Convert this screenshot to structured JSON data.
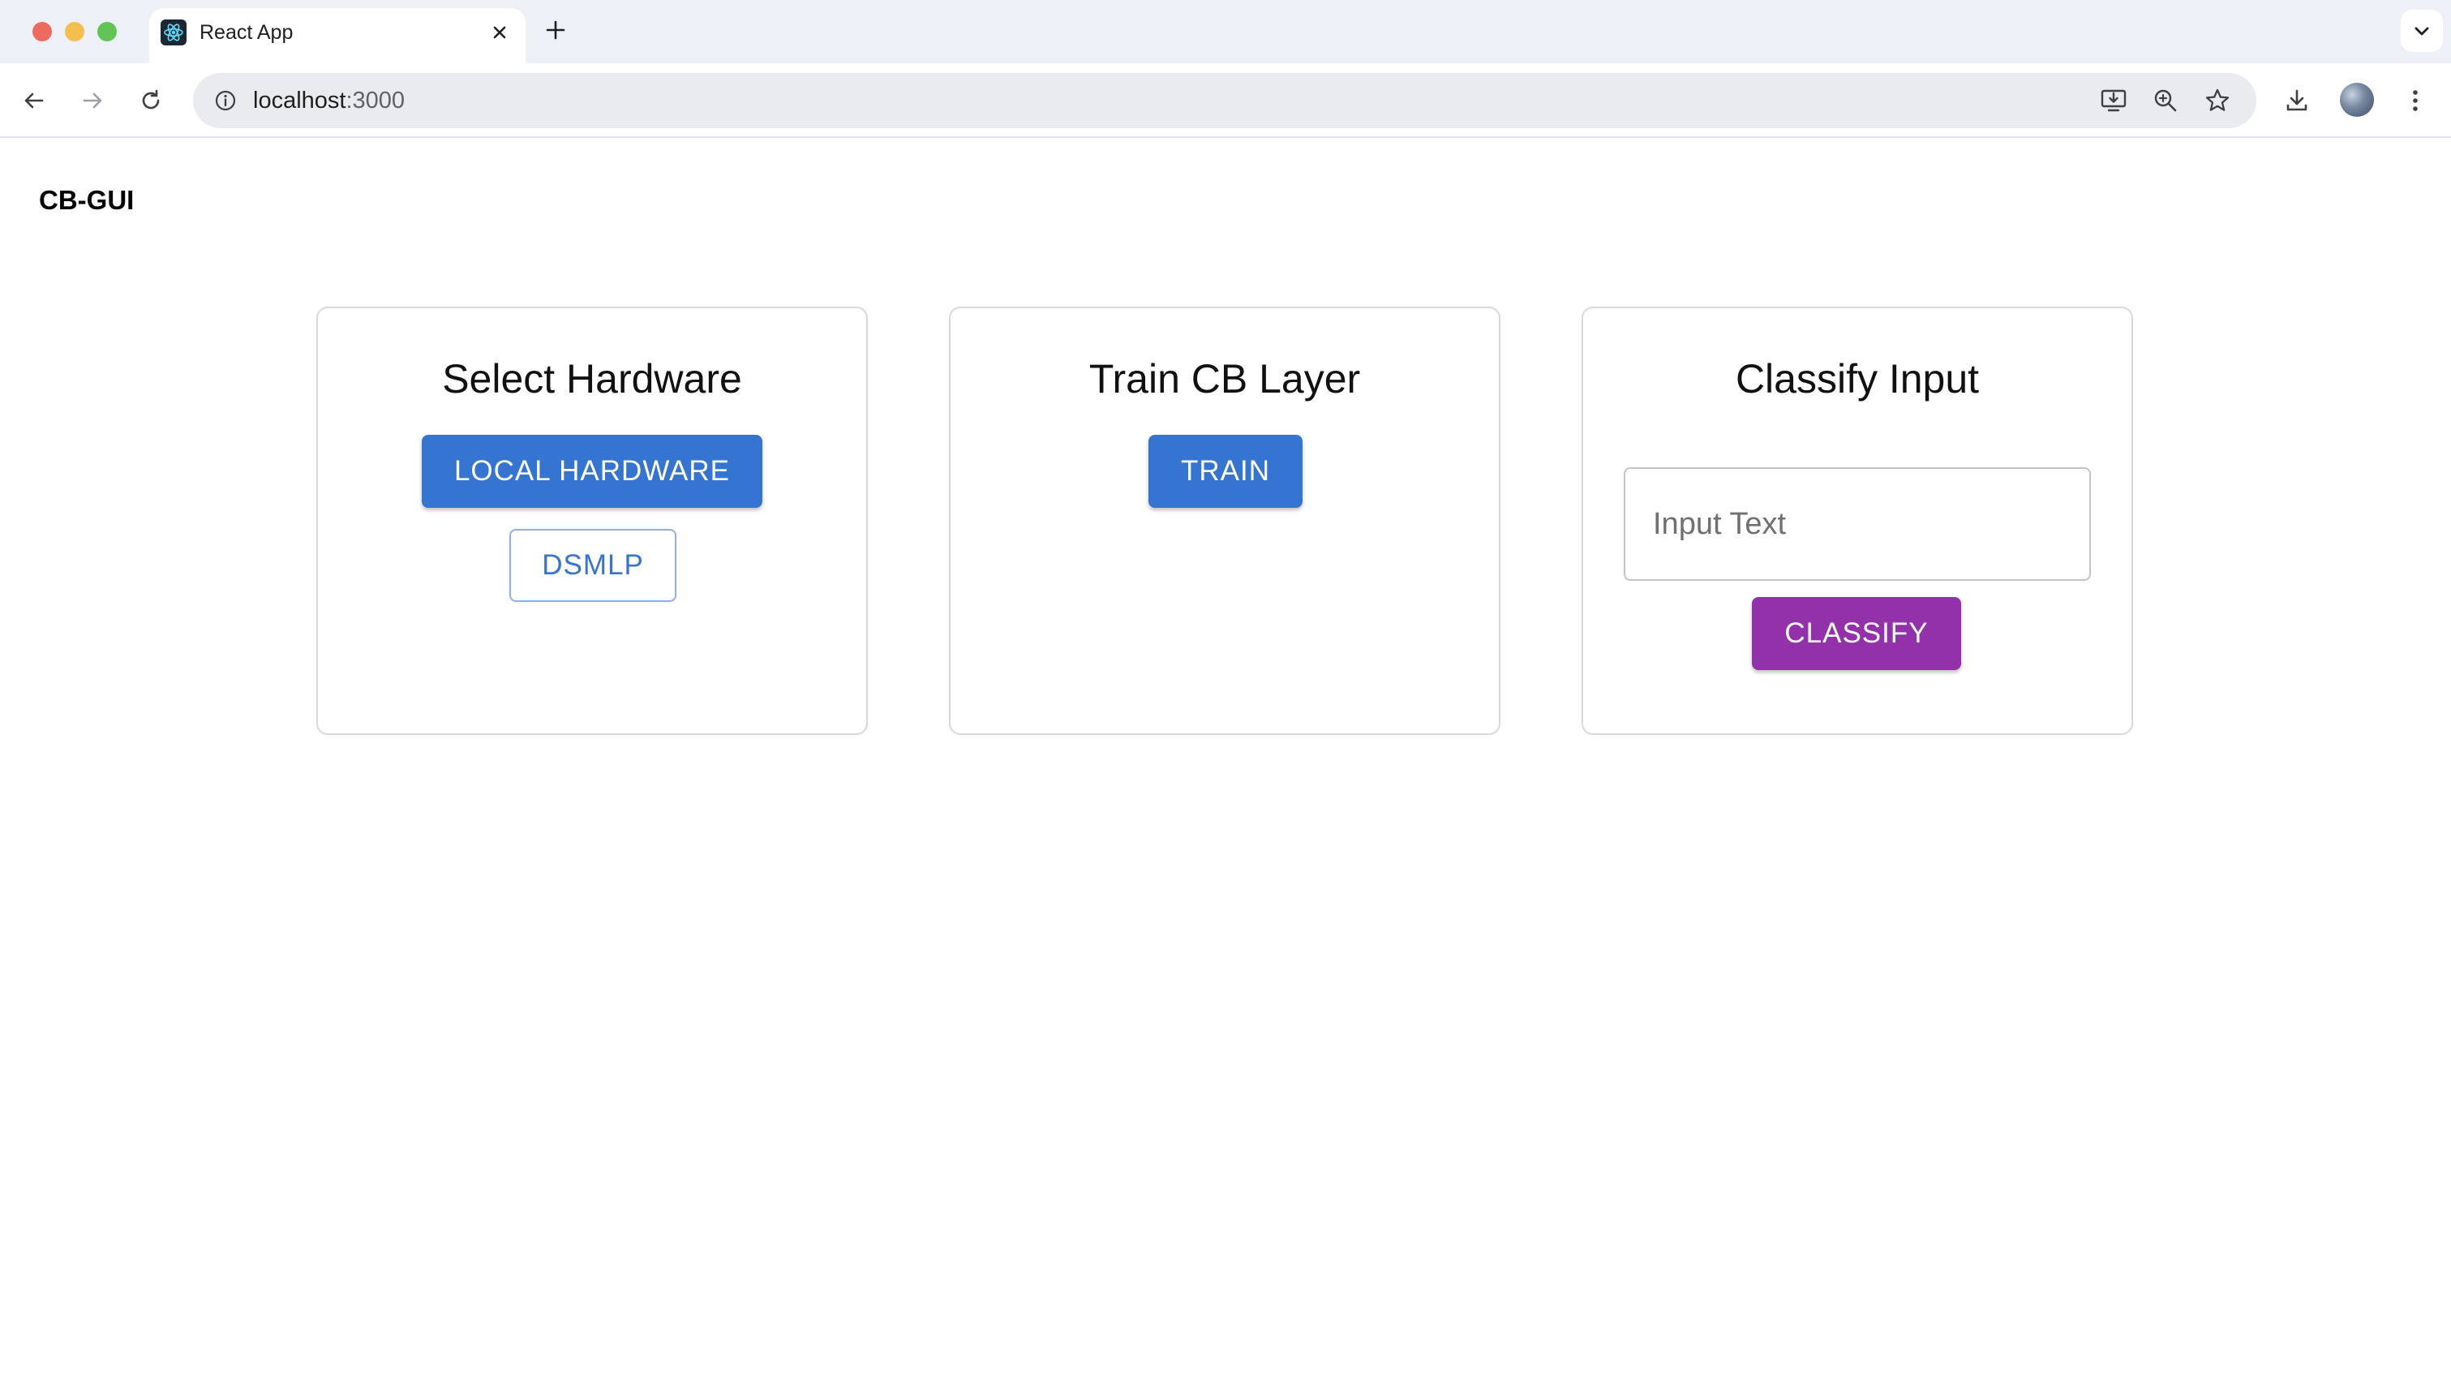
{
  "browser": {
    "tab": {
      "title": "React App"
    },
    "address": {
      "host": "localhost",
      "port": ":3000"
    }
  },
  "app": {
    "title": "CB-GUI"
  },
  "cards": {
    "hardware": {
      "title": "Select Hardware",
      "primary_label": "LOCAL HARDWARE",
      "secondary_label": "DSMLP"
    },
    "train": {
      "title": "Train CB Layer",
      "button_label": "TRAIN"
    },
    "classify": {
      "title": "Classify Input",
      "input_placeholder": "Input Text",
      "input_value": "",
      "button_label": "CLASSIFY"
    }
  },
  "colors": {
    "primary": "#3574d1",
    "secondary": "#9231aa"
  },
  "icons": [
    "react-logo-icon",
    "close-icon",
    "plus-icon",
    "chevron-down-icon",
    "back-arrow-icon",
    "forward-arrow-icon",
    "reload-icon",
    "info-icon",
    "install-app-icon",
    "zoom-icon",
    "star-icon",
    "download-icon",
    "profile-avatar",
    "kebab-menu-icon"
  ]
}
